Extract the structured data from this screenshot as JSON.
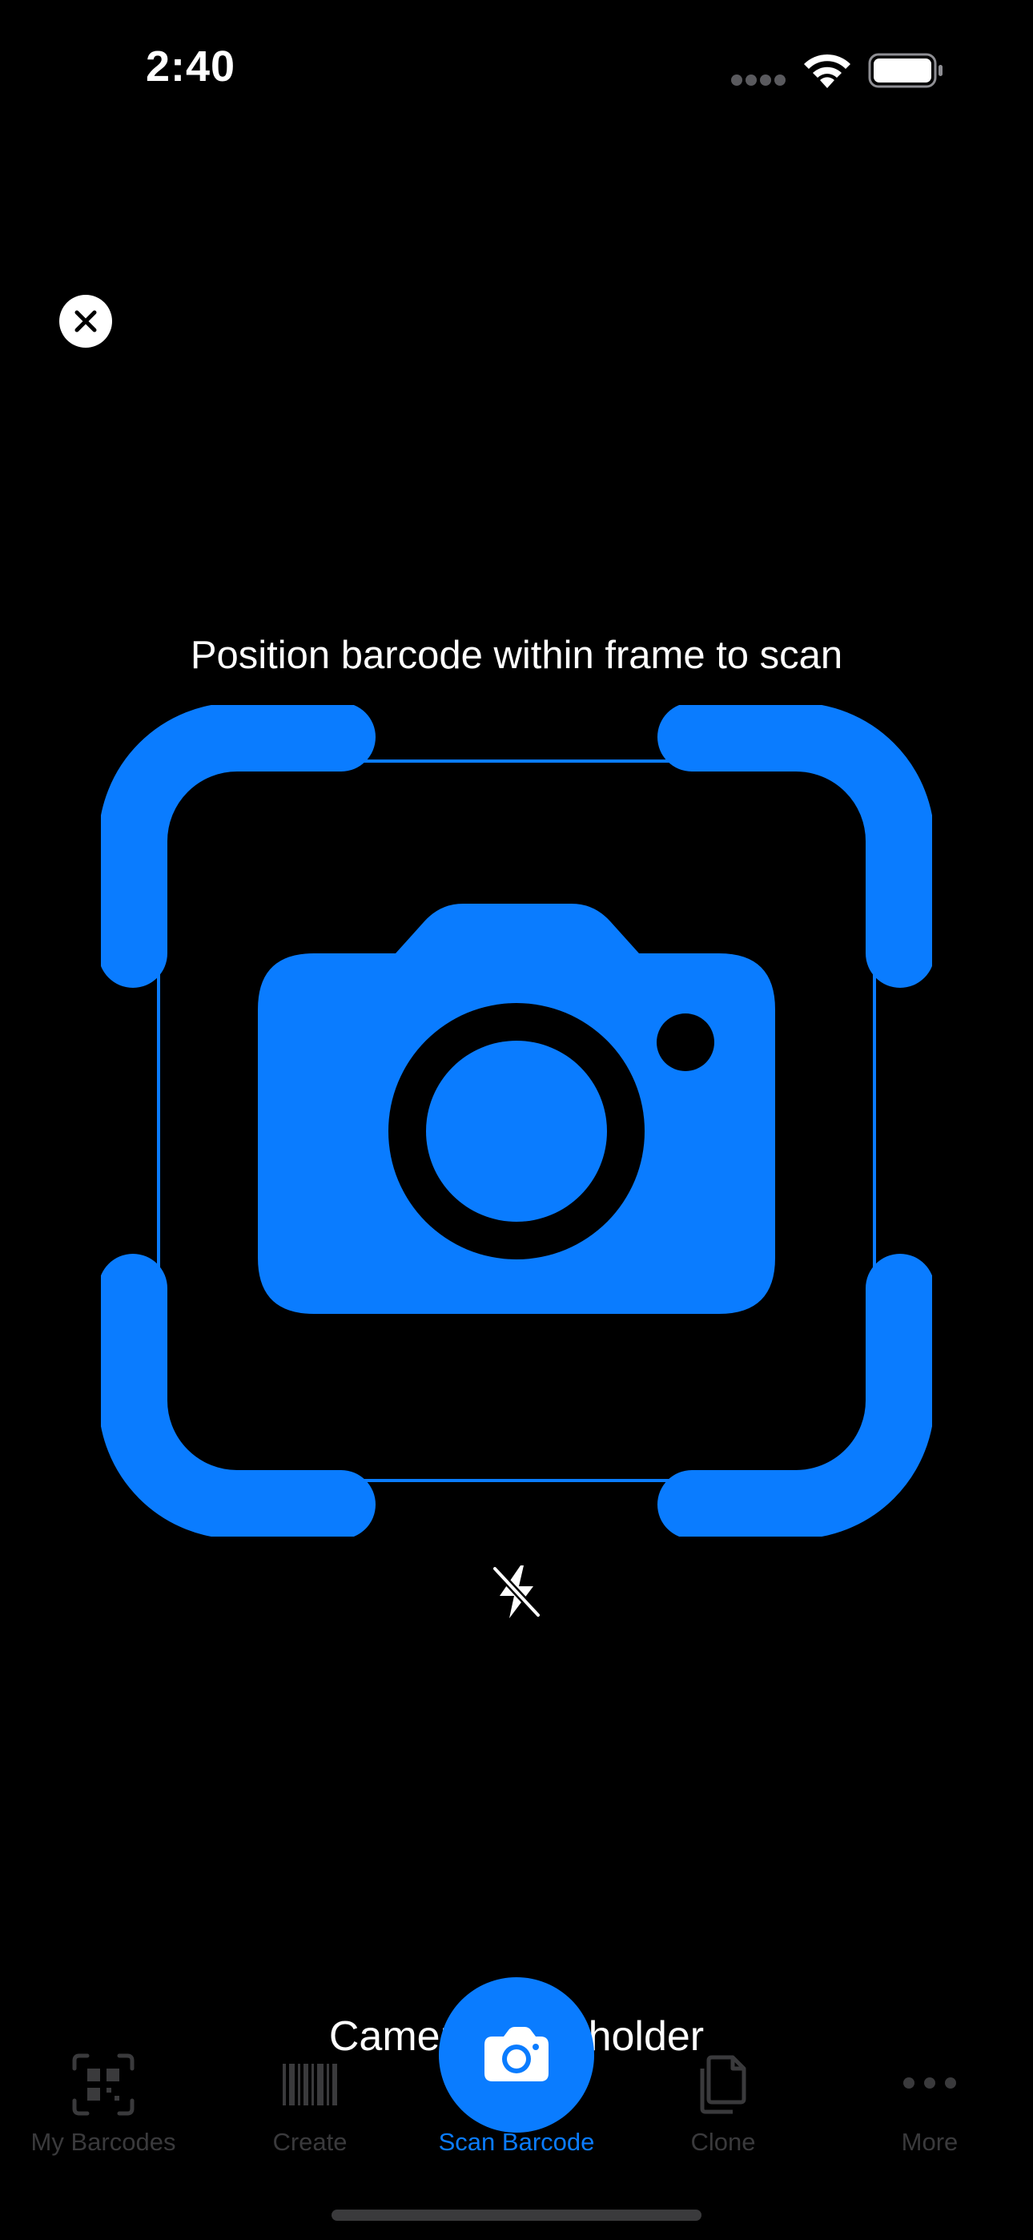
{
  "status_bar": {
    "time": "2:40",
    "icons": [
      "signal-dots-icon",
      "wifi-icon",
      "battery-icon"
    ]
  },
  "scanner": {
    "instruction": "Position barcode within frame to scan",
    "placeholder": "Camera placeholder",
    "close_icon": "close-icon",
    "flash_icon": "flash-off-icon",
    "frame_icon": "viewfinder-camera-icon"
  },
  "tab_bar": {
    "tabs": [
      {
        "label": "My Barcodes",
        "icon": "qr-code-icon",
        "active": false
      },
      {
        "label": "Create",
        "icon": "barcode-icon",
        "active": false
      },
      {
        "label": "Scan Barcode",
        "icon": "camera-icon",
        "active": true
      },
      {
        "label": "Clone",
        "icon": "documents-icon",
        "active": false
      },
      {
        "label": "More",
        "icon": "ellipsis-icon",
        "active": false
      }
    ]
  },
  "colors": {
    "accent": "#0a7cff",
    "background": "#000000",
    "inactive": "#3a3a3c",
    "text": "#ffffff"
  }
}
